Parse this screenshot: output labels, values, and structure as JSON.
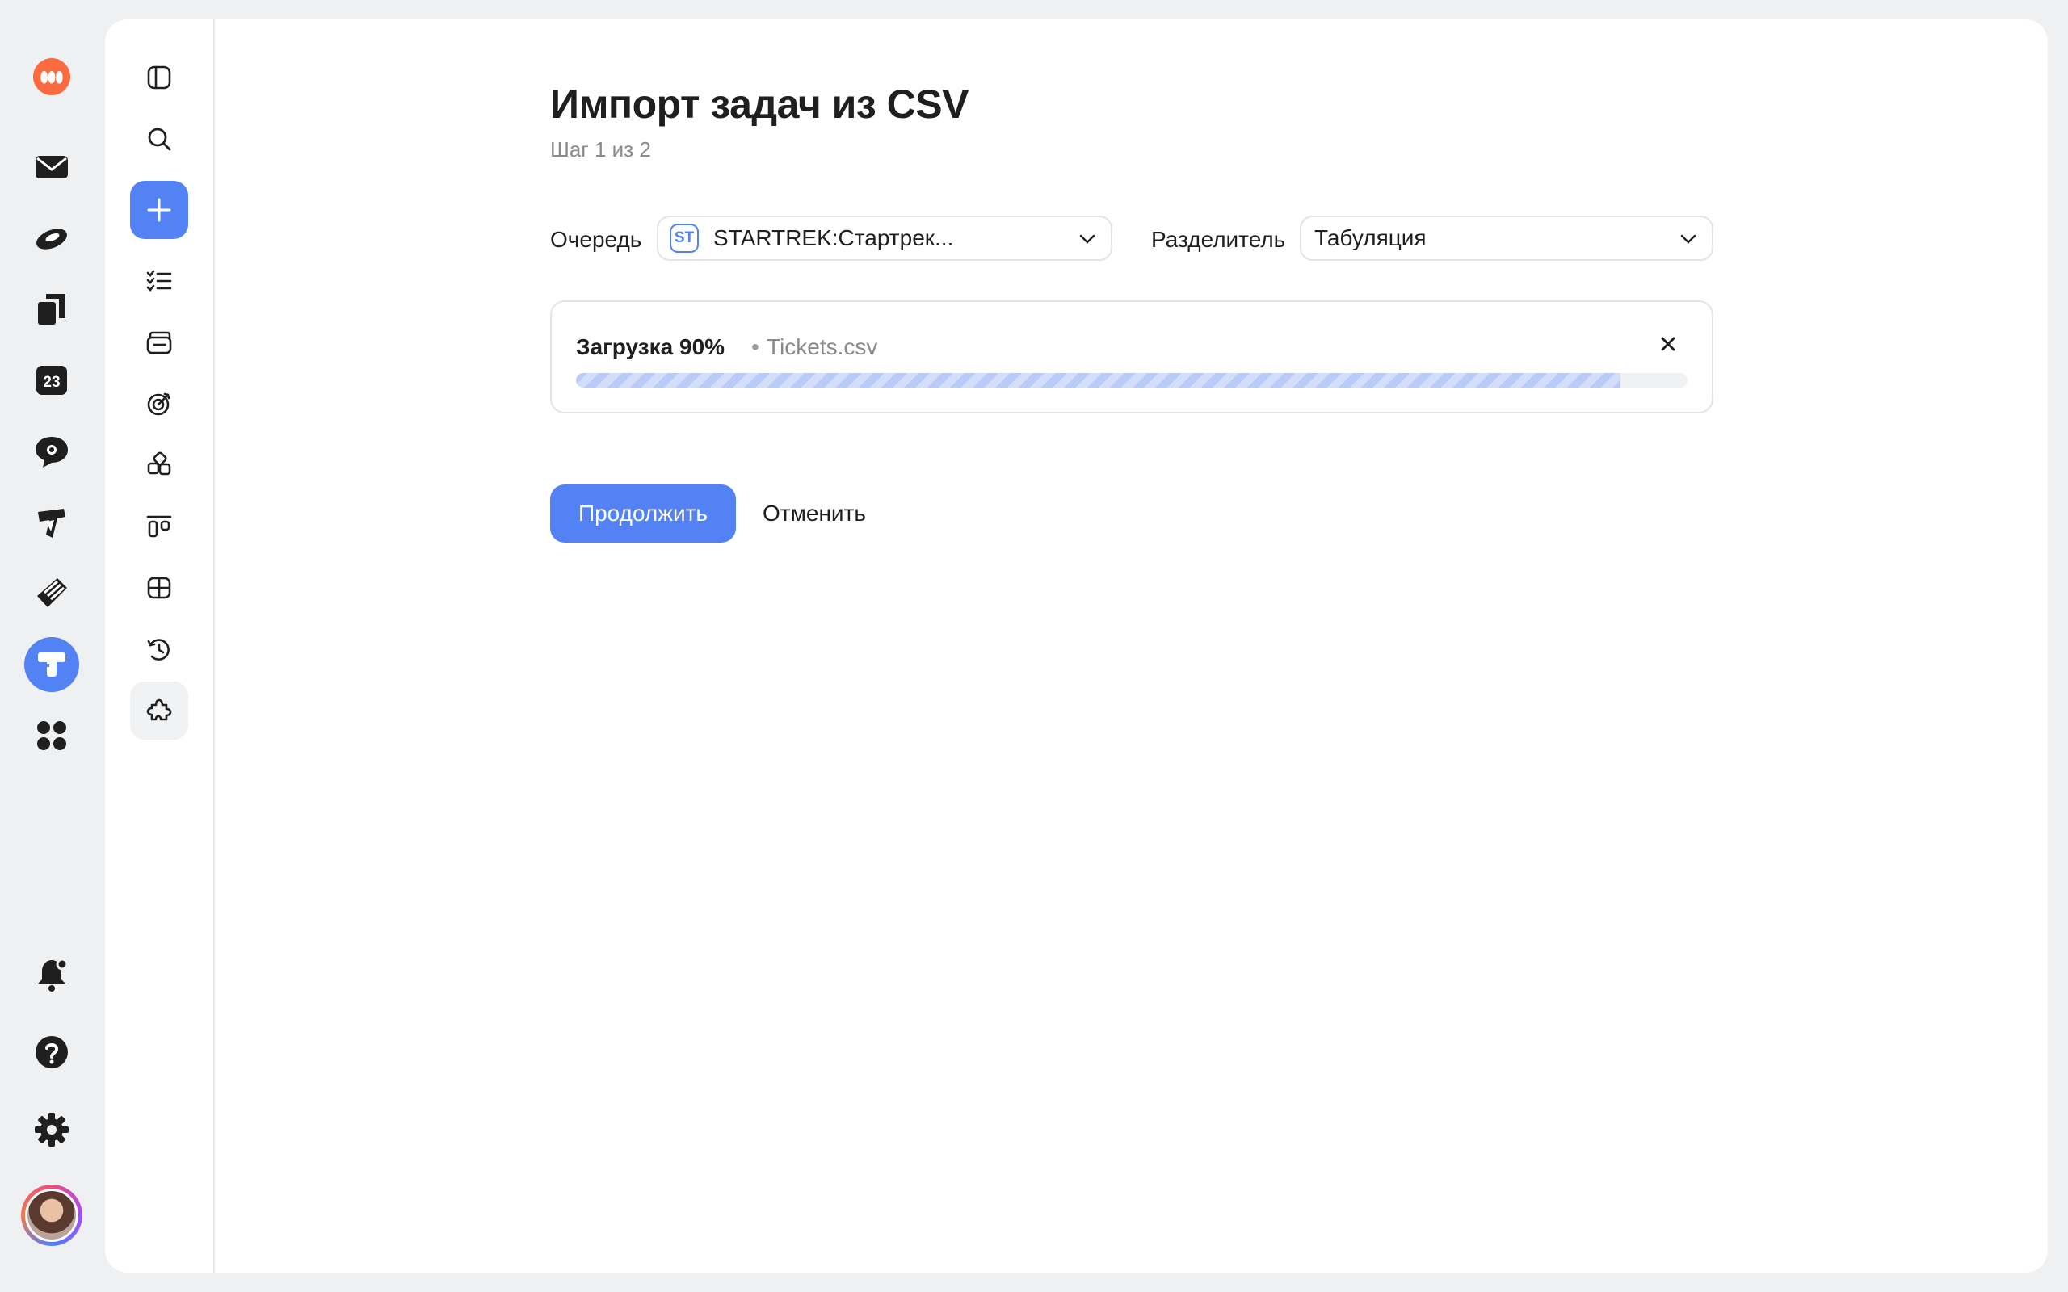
{
  "rail": {
    "services": [
      "logo-icon",
      "mail-icon",
      "disk-icon",
      "docs-icon",
      "calendar-icon",
      "messenger-icon",
      "forms-icon",
      "wiki-icon",
      "tracker-icon",
      "apps-icon"
    ],
    "calendar_day": "23",
    "bottom": [
      "notifications-icon",
      "help-icon",
      "settings-icon"
    ]
  },
  "subnav": {
    "items": [
      "sidebar-toggle-icon",
      "search-icon",
      "plus-icon",
      "tasks-icon",
      "portfolio-icon",
      "goals-icon",
      "components-icon",
      "boards-icon",
      "tables-icon",
      "history-icon",
      "plugins-icon"
    ]
  },
  "page": {
    "title": "Импорт задач из CSV",
    "step": "Шаг 1 из 2"
  },
  "queue": {
    "label": "Очередь",
    "badge": "ST",
    "value": "STARTREK:Стартрек..."
  },
  "delimiter": {
    "label": "Разделитель",
    "value": "Табуляция"
  },
  "upload": {
    "status": "Загрузка 90%",
    "separator": "•",
    "file": "Tickets.csv",
    "progress": 0.94
  },
  "actions": {
    "continue": "Продолжить",
    "cancel": "Отменить"
  },
  "colors": {
    "accent": "#5382f5",
    "logo": "#fc6b3f",
    "background": "#eef0f2"
  }
}
